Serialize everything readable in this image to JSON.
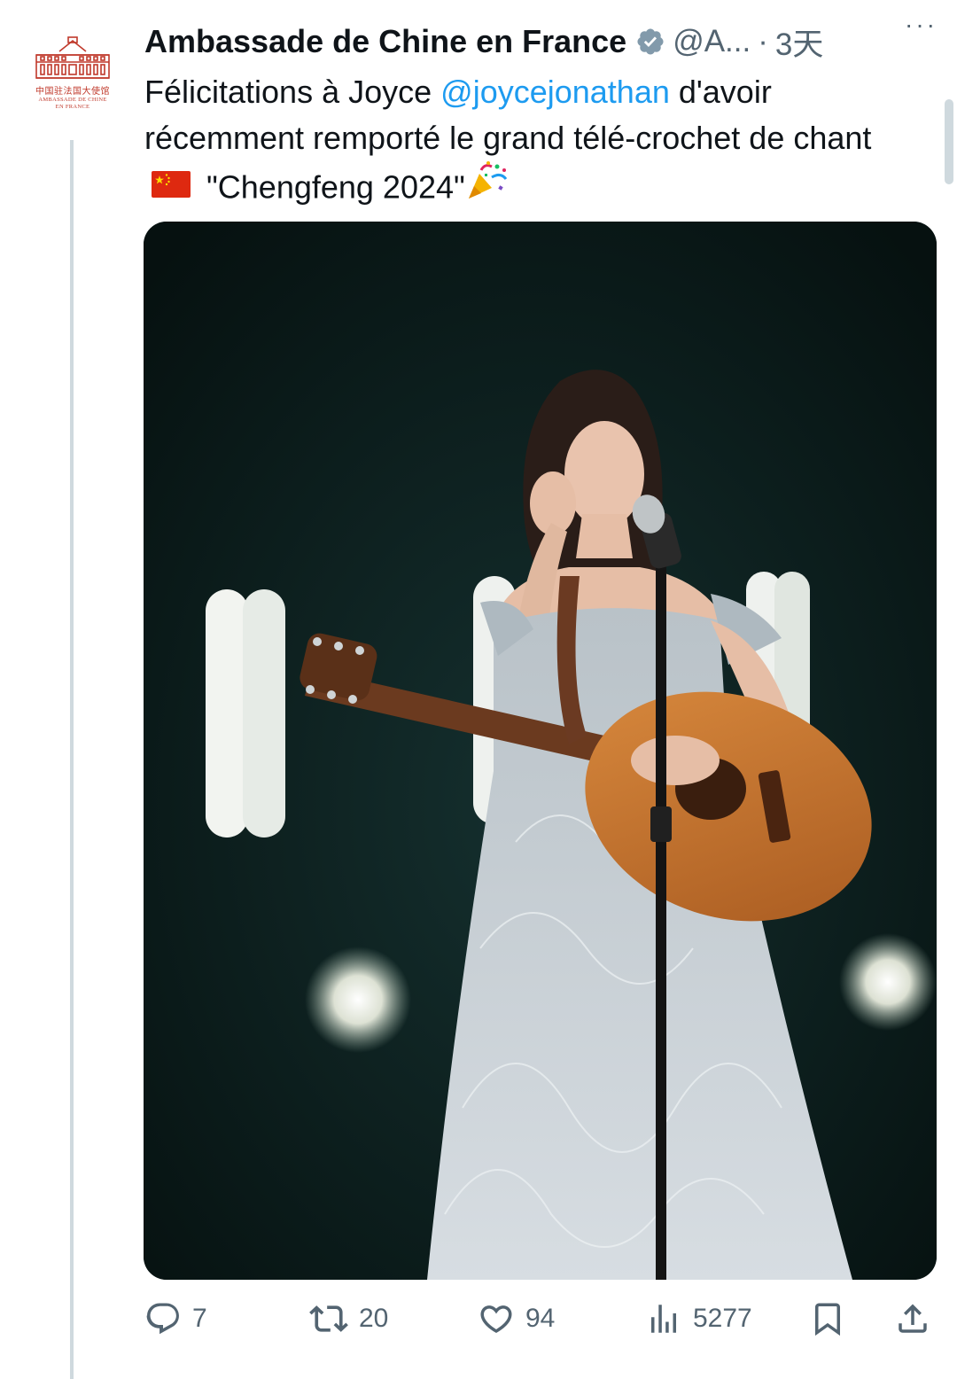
{
  "post": {
    "author_name": "Ambassade de Chine en France",
    "handle": "@A...",
    "separator": "·",
    "time": "3天",
    "more": "···",
    "avatar": {
      "cn_text": "中国驻法国大使馆",
      "fr_line1": "AMBASSADE DE CHINE",
      "fr_line2": "EN FRANCE"
    },
    "text_part1": "Félicitations à Joyce ",
    "mention": "@joycejonathan",
    "text_part2": " d'avoir récemment remporté le grand télé-crochet de chant",
    "text_part3": " \"Chengfeng 2024\"",
    "flag_icon": "china-flag-icon",
    "party_icon": "party-popper-icon"
  },
  "actions": {
    "reply_count": "7",
    "repost_count": "20",
    "like_count": "94",
    "view_count": "5277",
    "bookmark_icon": "bookmark-icon",
    "share_icon": "share-icon"
  },
  "colors": {
    "text": "#0f1419",
    "secondary": "#536471",
    "link": "#1d9bf0",
    "verified_badge": "#829aab",
    "avatar_red": "#c0392b"
  }
}
